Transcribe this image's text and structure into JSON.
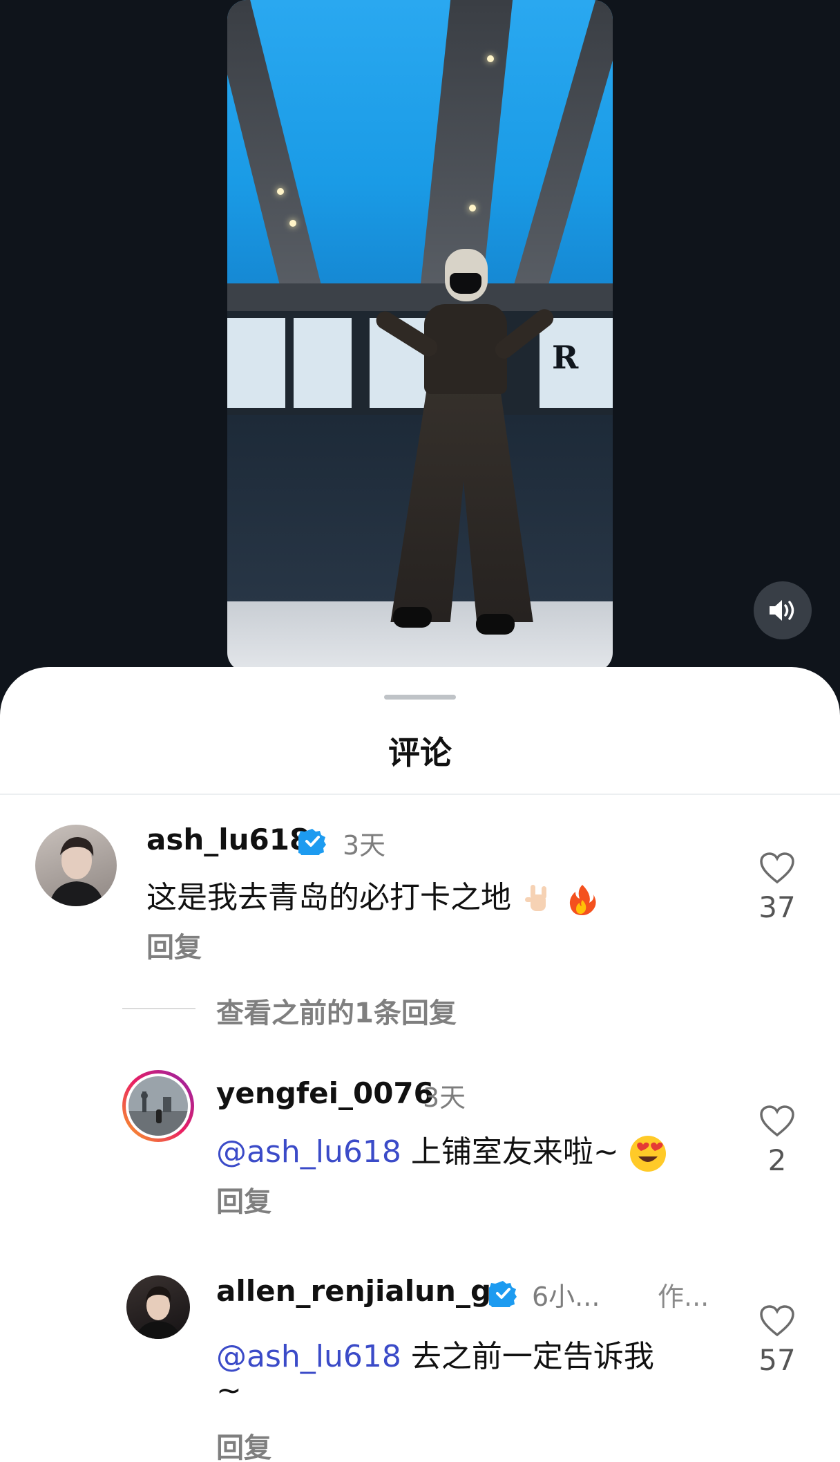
{
  "video": {
    "logo_letter": "R"
  },
  "sheet": {
    "title": "评论"
  },
  "comments": [
    {
      "username": "ash_lu618",
      "time": "3天",
      "text": "这是我去青岛的必打卡之地",
      "emojis": [
        "rock-hand",
        "fire"
      ],
      "reply_label": "回复",
      "likes": "37",
      "verified": true
    }
  ],
  "view_previous": "查看之前的1条回复",
  "replies": [
    {
      "username": "yengfei_0076",
      "time": "3天",
      "mention": "@ash_lu618",
      "text": " 上铺室友来啦~",
      "emoji": "heart-eyes",
      "reply_label": "回复",
      "likes": "2",
      "verified": false
    },
    {
      "username": "allen_renjialun_gc",
      "time": "6小...",
      "author_tag": "作...",
      "mention": "@ash_lu618",
      "text": " 去之前一定告诉我",
      "text_line2": "~",
      "reply_label": "回复",
      "likes": "57",
      "verified": true
    }
  ],
  "colors": {
    "mention": "#3b4bc8",
    "verified": "#1d9bf0",
    "background": "#0f141b"
  }
}
